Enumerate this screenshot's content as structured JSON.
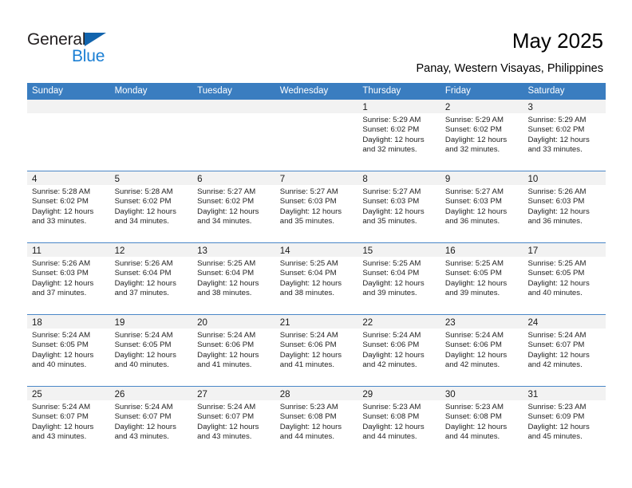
{
  "brand": {
    "name_part1": "General",
    "name_part2": "Blue",
    "flag_icon": "triangle-flag-icon",
    "accent_color": "#1b7fd4",
    "dark_color": "#231f20"
  },
  "header": {
    "title": "May 2025",
    "subtitle": "Panay, Western Visayas, Philippines"
  },
  "calendar": {
    "header_bg": "#3a7dc0",
    "band_bg": "#f2f2f2",
    "weekday_headers": [
      "Sunday",
      "Monday",
      "Tuesday",
      "Wednesday",
      "Thursday",
      "Friday",
      "Saturday"
    ],
    "weeks": [
      [
        {
          "day": "",
          "empty": true,
          "line1": "",
          "line2": "",
          "line3": "",
          "line4": ""
        },
        {
          "day": "",
          "empty": true,
          "line1": "",
          "line2": "",
          "line3": "",
          "line4": ""
        },
        {
          "day": "",
          "empty": true,
          "line1": "",
          "line2": "",
          "line3": "",
          "line4": ""
        },
        {
          "day": "",
          "empty": true,
          "line1": "",
          "line2": "",
          "line3": "",
          "line4": ""
        },
        {
          "day": "1",
          "empty": false,
          "line1": "Sunrise: 5:29 AM",
          "line2": "Sunset: 6:02 PM",
          "line3": "Daylight: 12 hours",
          "line4": "and 32 minutes."
        },
        {
          "day": "2",
          "empty": false,
          "line1": "Sunrise: 5:29 AM",
          "line2": "Sunset: 6:02 PM",
          "line3": "Daylight: 12 hours",
          "line4": "and 32 minutes."
        },
        {
          "day": "3",
          "empty": false,
          "line1": "Sunrise: 5:29 AM",
          "line2": "Sunset: 6:02 PM",
          "line3": "Daylight: 12 hours",
          "line4": "and 33 minutes."
        }
      ],
      [
        {
          "day": "4",
          "empty": false,
          "line1": "Sunrise: 5:28 AM",
          "line2": "Sunset: 6:02 PM",
          "line3": "Daylight: 12 hours",
          "line4": "and 33 minutes."
        },
        {
          "day": "5",
          "empty": false,
          "line1": "Sunrise: 5:28 AM",
          "line2": "Sunset: 6:02 PM",
          "line3": "Daylight: 12 hours",
          "line4": "and 34 minutes."
        },
        {
          "day": "6",
          "empty": false,
          "line1": "Sunrise: 5:27 AM",
          "line2": "Sunset: 6:02 PM",
          "line3": "Daylight: 12 hours",
          "line4": "and 34 minutes."
        },
        {
          "day": "7",
          "empty": false,
          "line1": "Sunrise: 5:27 AM",
          "line2": "Sunset: 6:03 PM",
          "line3": "Daylight: 12 hours",
          "line4": "and 35 minutes."
        },
        {
          "day": "8",
          "empty": false,
          "line1": "Sunrise: 5:27 AM",
          "line2": "Sunset: 6:03 PM",
          "line3": "Daylight: 12 hours",
          "line4": "and 35 minutes."
        },
        {
          "day": "9",
          "empty": false,
          "line1": "Sunrise: 5:27 AM",
          "line2": "Sunset: 6:03 PM",
          "line3": "Daylight: 12 hours",
          "line4": "and 36 minutes."
        },
        {
          "day": "10",
          "empty": false,
          "line1": "Sunrise: 5:26 AM",
          "line2": "Sunset: 6:03 PM",
          "line3": "Daylight: 12 hours",
          "line4": "and 36 minutes."
        }
      ],
      [
        {
          "day": "11",
          "empty": false,
          "line1": "Sunrise: 5:26 AM",
          "line2": "Sunset: 6:03 PM",
          "line3": "Daylight: 12 hours",
          "line4": "and 37 minutes."
        },
        {
          "day": "12",
          "empty": false,
          "line1": "Sunrise: 5:26 AM",
          "line2": "Sunset: 6:04 PM",
          "line3": "Daylight: 12 hours",
          "line4": "and 37 minutes."
        },
        {
          "day": "13",
          "empty": false,
          "line1": "Sunrise: 5:25 AM",
          "line2": "Sunset: 6:04 PM",
          "line3": "Daylight: 12 hours",
          "line4": "and 38 minutes."
        },
        {
          "day": "14",
          "empty": false,
          "line1": "Sunrise: 5:25 AM",
          "line2": "Sunset: 6:04 PM",
          "line3": "Daylight: 12 hours",
          "line4": "and 38 minutes."
        },
        {
          "day": "15",
          "empty": false,
          "line1": "Sunrise: 5:25 AM",
          "line2": "Sunset: 6:04 PM",
          "line3": "Daylight: 12 hours",
          "line4": "and 39 minutes."
        },
        {
          "day": "16",
          "empty": false,
          "line1": "Sunrise: 5:25 AM",
          "line2": "Sunset: 6:05 PM",
          "line3": "Daylight: 12 hours",
          "line4": "and 39 minutes."
        },
        {
          "day": "17",
          "empty": false,
          "line1": "Sunrise: 5:25 AM",
          "line2": "Sunset: 6:05 PM",
          "line3": "Daylight: 12 hours",
          "line4": "and 40 minutes."
        }
      ],
      [
        {
          "day": "18",
          "empty": false,
          "line1": "Sunrise: 5:24 AM",
          "line2": "Sunset: 6:05 PM",
          "line3": "Daylight: 12 hours",
          "line4": "and 40 minutes."
        },
        {
          "day": "19",
          "empty": false,
          "line1": "Sunrise: 5:24 AM",
          "line2": "Sunset: 6:05 PM",
          "line3": "Daylight: 12 hours",
          "line4": "and 40 minutes."
        },
        {
          "day": "20",
          "empty": false,
          "line1": "Sunrise: 5:24 AM",
          "line2": "Sunset: 6:06 PM",
          "line3": "Daylight: 12 hours",
          "line4": "and 41 minutes."
        },
        {
          "day": "21",
          "empty": false,
          "line1": "Sunrise: 5:24 AM",
          "line2": "Sunset: 6:06 PM",
          "line3": "Daylight: 12 hours",
          "line4": "and 41 minutes."
        },
        {
          "day": "22",
          "empty": false,
          "line1": "Sunrise: 5:24 AM",
          "line2": "Sunset: 6:06 PM",
          "line3": "Daylight: 12 hours",
          "line4": "and 42 minutes."
        },
        {
          "day": "23",
          "empty": false,
          "line1": "Sunrise: 5:24 AM",
          "line2": "Sunset: 6:06 PM",
          "line3": "Daylight: 12 hours",
          "line4": "and 42 minutes."
        },
        {
          "day": "24",
          "empty": false,
          "line1": "Sunrise: 5:24 AM",
          "line2": "Sunset: 6:07 PM",
          "line3": "Daylight: 12 hours",
          "line4": "and 42 minutes."
        }
      ],
      [
        {
          "day": "25",
          "empty": false,
          "line1": "Sunrise: 5:24 AM",
          "line2": "Sunset: 6:07 PM",
          "line3": "Daylight: 12 hours",
          "line4": "and 43 minutes."
        },
        {
          "day": "26",
          "empty": false,
          "line1": "Sunrise: 5:24 AM",
          "line2": "Sunset: 6:07 PM",
          "line3": "Daylight: 12 hours",
          "line4": "and 43 minutes."
        },
        {
          "day": "27",
          "empty": false,
          "line1": "Sunrise: 5:24 AM",
          "line2": "Sunset: 6:07 PM",
          "line3": "Daylight: 12 hours",
          "line4": "and 43 minutes."
        },
        {
          "day": "28",
          "empty": false,
          "line1": "Sunrise: 5:23 AM",
          "line2": "Sunset: 6:08 PM",
          "line3": "Daylight: 12 hours",
          "line4": "and 44 minutes."
        },
        {
          "day": "29",
          "empty": false,
          "line1": "Sunrise: 5:23 AM",
          "line2": "Sunset: 6:08 PM",
          "line3": "Daylight: 12 hours",
          "line4": "and 44 minutes."
        },
        {
          "day": "30",
          "empty": false,
          "line1": "Sunrise: 5:23 AM",
          "line2": "Sunset: 6:08 PM",
          "line3": "Daylight: 12 hours",
          "line4": "and 44 minutes."
        },
        {
          "day": "31",
          "empty": false,
          "line1": "Sunrise: 5:23 AM",
          "line2": "Sunset: 6:09 PM",
          "line3": "Daylight: 12 hours",
          "line4": "and 45 minutes."
        }
      ]
    ]
  }
}
